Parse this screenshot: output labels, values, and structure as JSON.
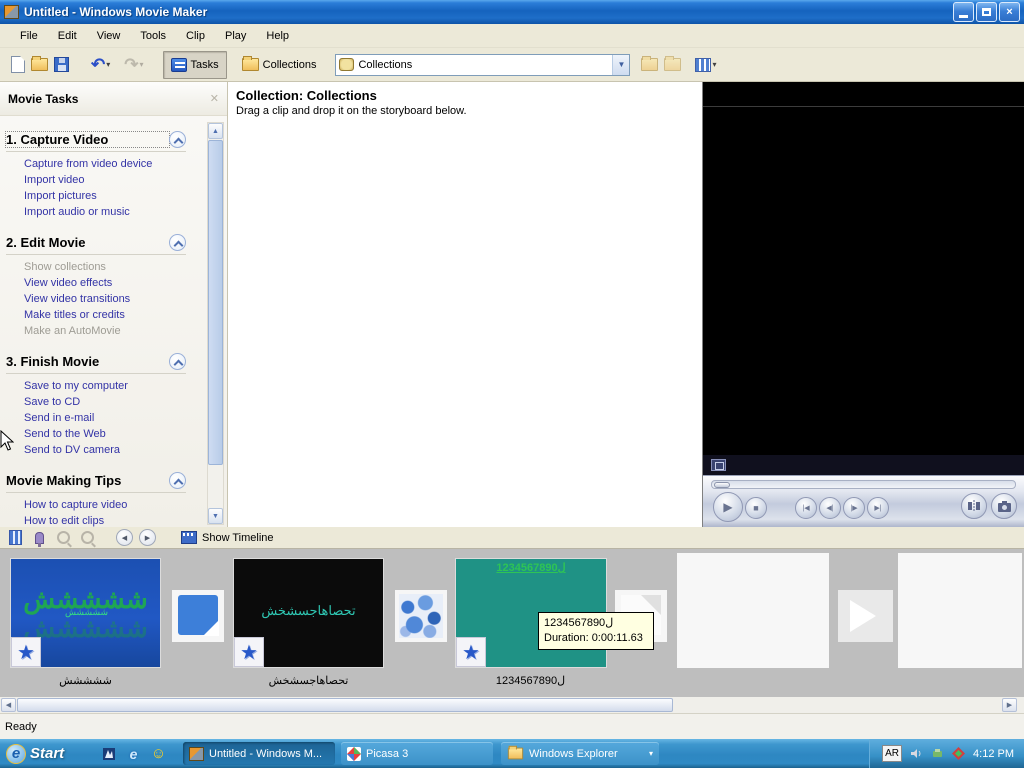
{
  "window": {
    "title": "Untitled - Windows Movie Maker"
  },
  "menu": {
    "items": [
      "File",
      "Edit",
      "View",
      "Tools",
      "Clip",
      "Play",
      "Help"
    ]
  },
  "toolbar": {
    "tasks_label": "Tasks",
    "collections_label": "Collections",
    "combo_value": "Collections"
  },
  "task_pane": {
    "title": "Movie Tasks",
    "sections": [
      {
        "title": "1. Capture Video",
        "links": [
          "Capture from video device",
          "Import video",
          "Import pictures",
          "Import audio or music"
        ]
      },
      {
        "title": "2. Edit Movie",
        "links": [
          "Show collections",
          "View video effects",
          "View video transitions",
          "Make titles or credits",
          "Make an AutoMovie"
        ]
      },
      {
        "title": "3. Finish Movie",
        "links": [
          "Save to my computer",
          "Save to CD",
          "Send in e-mail",
          "Send to the Web",
          "Send to DV camera"
        ]
      },
      {
        "title": "Movie Making Tips",
        "links": [
          "How to capture video",
          "How to edit clips"
        ]
      }
    ]
  },
  "collection": {
    "title": "Collection: Collections",
    "subtitle": "Drag a clip and drop it on the storyboard below."
  },
  "timeline_bar": {
    "show_timeline": "Show Timeline"
  },
  "storyboard": {
    "clips": [
      {
        "caption": "ششششش"
      },
      {
        "caption": "تحصاهاجسشخش"
      },
      {
        "caption": "1234567890ل"
      }
    ],
    "tooltip": {
      "title": "1234567890ل",
      "duration": "Duration:  0:00:11.63"
    }
  },
  "status": {
    "text": "Ready"
  },
  "taskbar": {
    "start_label": "Start",
    "buttons": [
      {
        "label": "Untitled - Windows M..."
      },
      {
        "label": "Picasa 3"
      },
      {
        "label": "Windows Explorer"
      }
    ],
    "tray": {
      "language": "AR",
      "time": "4:12 PM"
    }
  },
  "icons": {
    "undo": "↶",
    "redo": "↷",
    "dropdown": "▾",
    "combo_arrow": "▼",
    "up_arrow": "▲",
    "down_arrow": "▼",
    "left_arrow": "◀",
    "right_arrow": "▶",
    "play": "▶",
    "stop": "■",
    "prev": "|◀",
    "step_back": "◀|",
    "step_fwd": "|▶",
    "next": "▶|",
    "rewind": "◀",
    "tl_play": "▶",
    "star": "★",
    "smiley": "☺",
    "close": "×",
    "pane_close": "✕",
    "e_logo": "e",
    "plus": "+",
    "minus": "-"
  },
  "colors": {
    "titlebar_blue": "#1E6CC8",
    "taskbar_blue": "#3690C6",
    "link_navy": "#3333A6",
    "storyboard_gray": "#BEBEBE",
    "clip1_bg": "#1C50B2",
    "clip1_text": "#1FA653",
    "clip2_bg": "#0B0B0B",
    "clip2_text": "#2FC8B4",
    "clip3_bg": "#1F9285",
    "clip3_text": "#2EC455",
    "tooltip_bg": "#FFFFE1"
  }
}
